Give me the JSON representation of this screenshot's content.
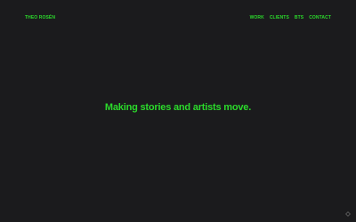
{
  "header": {
    "logo": "THEO ROSÉN",
    "nav": [
      {
        "label": "WORK"
      },
      {
        "label": "CLIENTS"
      },
      {
        "label": "BTS"
      },
      {
        "label": "CONTACT"
      }
    ]
  },
  "hero": {
    "headline": "Making stories and artists move."
  },
  "corner": {
    "icon": "diamond-icon"
  },
  "colors": {
    "background": "#1b1b1d",
    "accent": "#2bd92b"
  }
}
